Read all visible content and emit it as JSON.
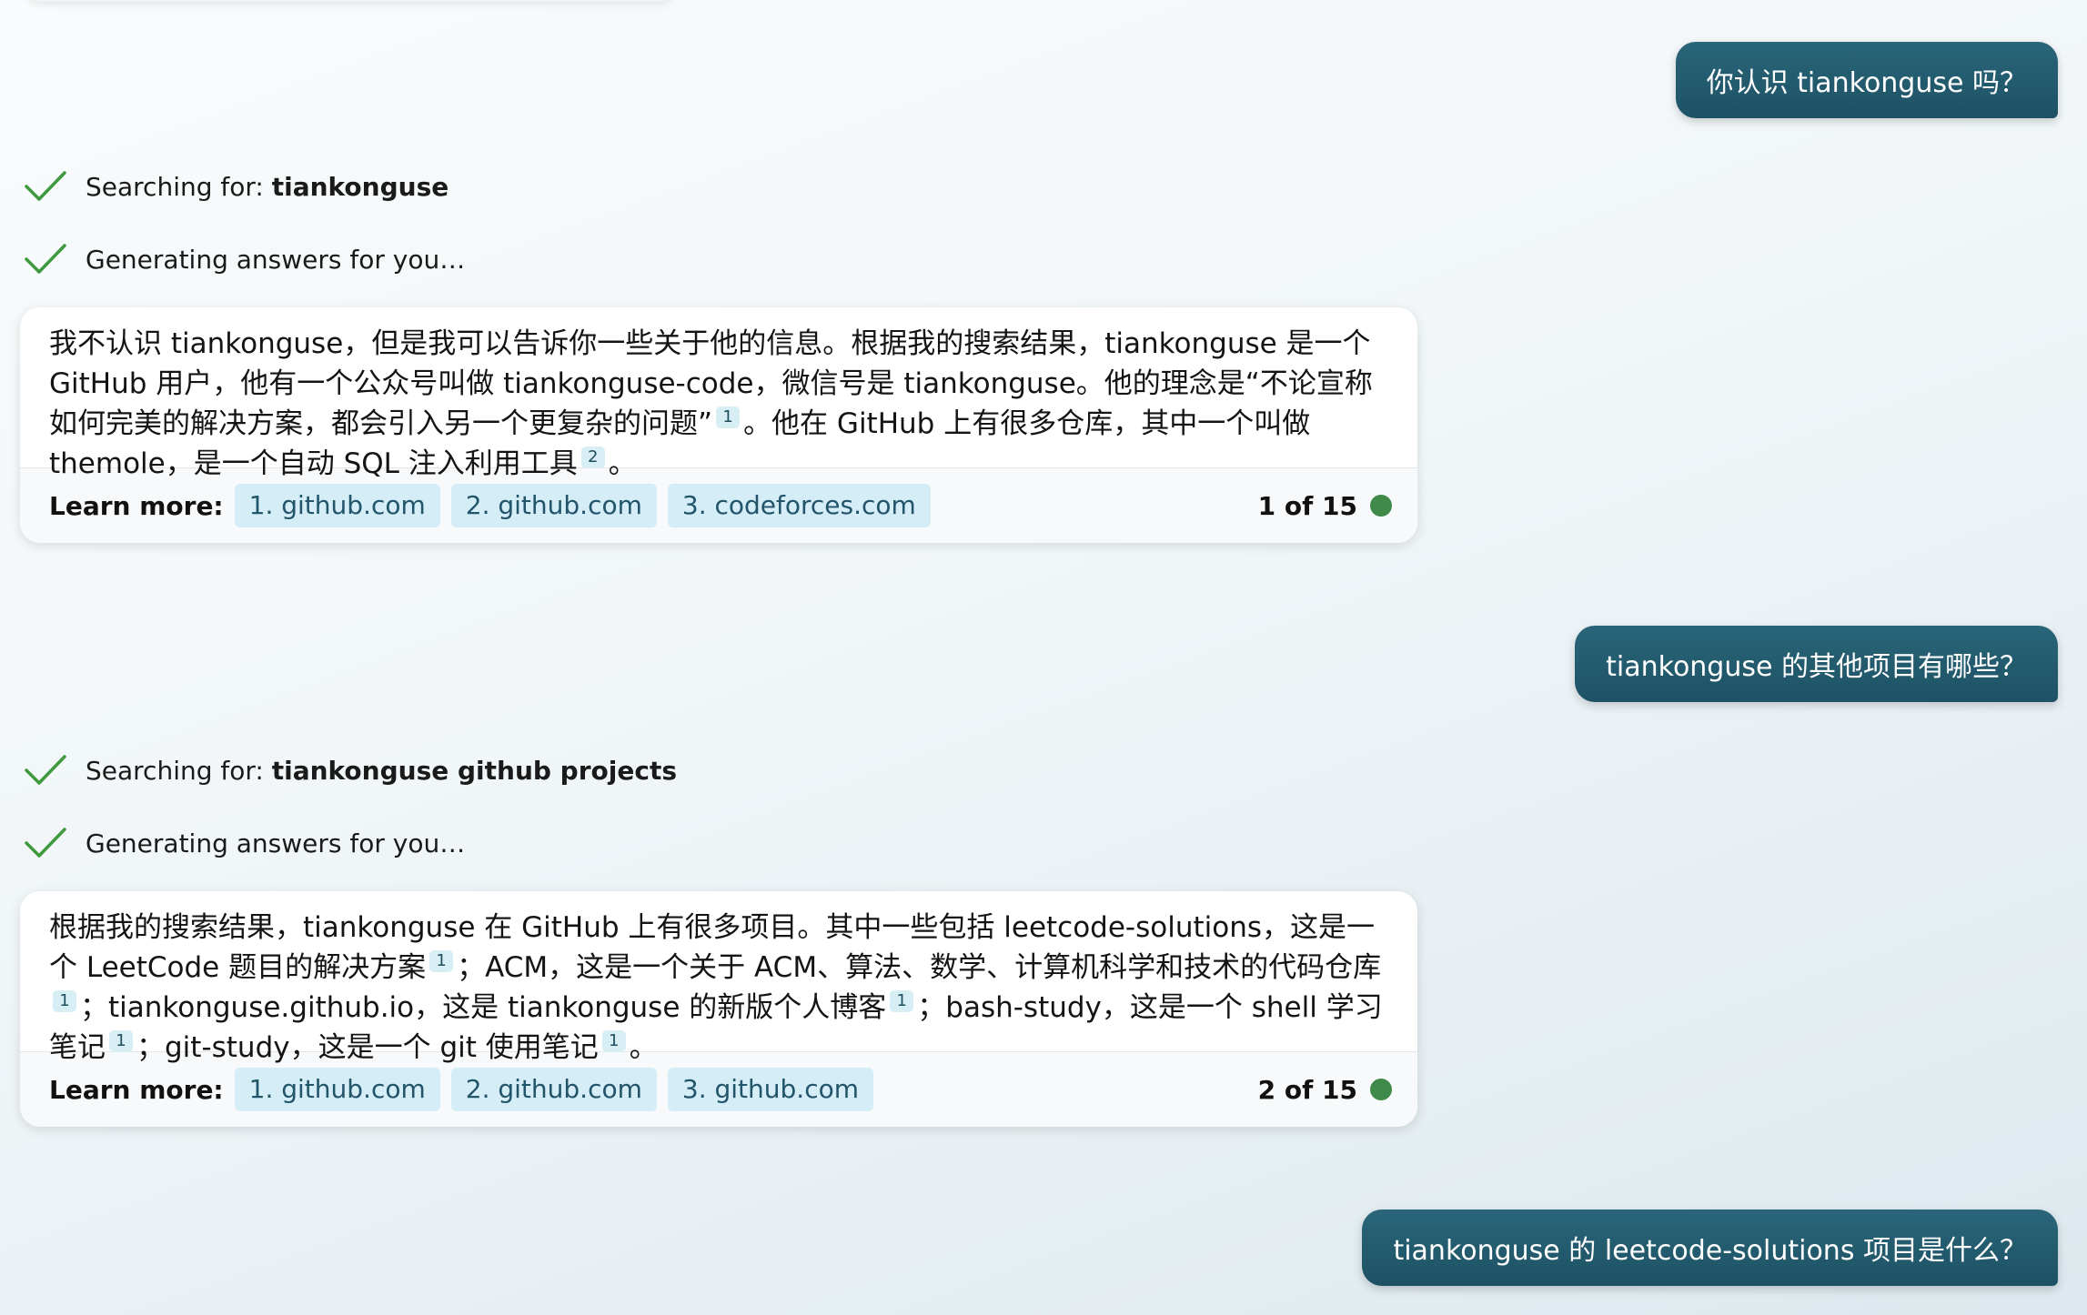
{
  "conversation": {
    "user_messages": [
      "你认识 tiankonguse 吗？",
      "tiankonguse 的其他项目有哪些？",
      "tiankonguse 的 leetcode-solutions 项目是什么？"
    ],
    "turns": [
      {
        "search_prefix": "Searching for: ",
        "search_query": "tiankonguse",
        "generating": "Generating answers for you…",
        "answer_segments": [
          "我不认识 tiankonguse，但是我可以告诉你一些关于他的信息。根据我的搜索结果，tiankonguse 是一个 GitHub 用户，他有一个公众号叫做 tiankonguse-code，微信号是 tiankonguse。他的理念是“不论宣称如何完美的解决方案，都会引入另一个更复杂的问题”",
          "1",
          "。他在 GitHub 上有很多仓库，其中一个叫做 themole，是一个自动 SQL 注入利用工具",
          "2",
          "。"
        ],
        "learn_more_label": "Learn more:",
        "sources": [
          "1. github.com",
          "2. github.com",
          "3. codeforces.com"
        ],
        "counter": "1 of 15"
      },
      {
        "search_prefix": "Searching for: ",
        "search_query": "tiankonguse github projects",
        "generating": "Generating answers for you…",
        "answer_segments": [
          "根据我的搜索结果，tiankonguse 在 GitHub 上有很多项目。其中一些包括 leetcode-solutions，这是一个 LeetCode 题目的解决方案",
          "1",
          "；ACM，这是一个关于 ACM、算法、数学、计算机科学和技术的代码仓库",
          "1",
          "；tiankonguse.github.io，这是 tiankonguse 的新版个人博客",
          "1",
          "；bash-study，这是一个 shell 学习笔记",
          "1",
          "；git-study，这是一个 git 使用笔记",
          "1",
          "。"
        ],
        "learn_more_label": "Learn more:",
        "sources": [
          "1. github.com",
          "2. github.com",
          "3. github.com"
        ],
        "counter": "2 of 15"
      }
    ]
  },
  "colors": {
    "user_bubble": "#21596b",
    "check": "#3f9a3f",
    "status_dot": "#3f8a4a",
    "chip_bg": "#d4edf6",
    "chip_text": "#22546a"
  }
}
